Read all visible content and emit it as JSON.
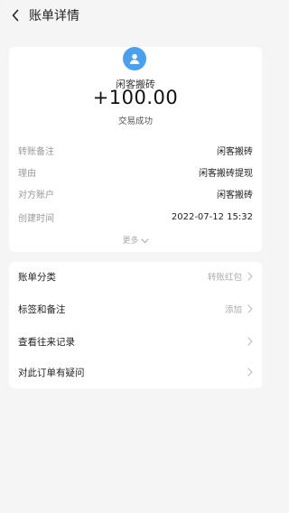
{
  "nav": {
    "title": "账单详情"
  },
  "transaction": {
    "payee": "闲客搬砖",
    "amount": "+100.00",
    "status": "交易成功"
  },
  "details": [
    {
      "key": "转账备注",
      "value": "闲客搬砖"
    },
    {
      "key": "理由",
      "value": "闲客搬砖提现"
    },
    {
      "key": "对方账户",
      "value": "闲客搬砖"
    },
    {
      "key": "创建时间",
      "value": "2022-07-12 15:32"
    }
  ],
  "more_label": "更多",
  "options": [
    {
      "label": "账单分类",
      "value": "转账红包"
    },
    {
      "label": "标签和备注",
      "value": "添加"
    },
    {
      "label": "查看往来记录",
      "value": ""
    },
    {
      "label": "对此订单有疑问",
      "value": ""
    }
  ],
  "colors": {
    "avatar": "#4aa0ef",
    "background": "#f5f5f5"
  },
  "icons": {
    "back": "chevron-left-icon",
    "avatar": "user-icon",
    "more": "chevron-down-icon",
    "row": "chevron-right-icon"
  }
}
